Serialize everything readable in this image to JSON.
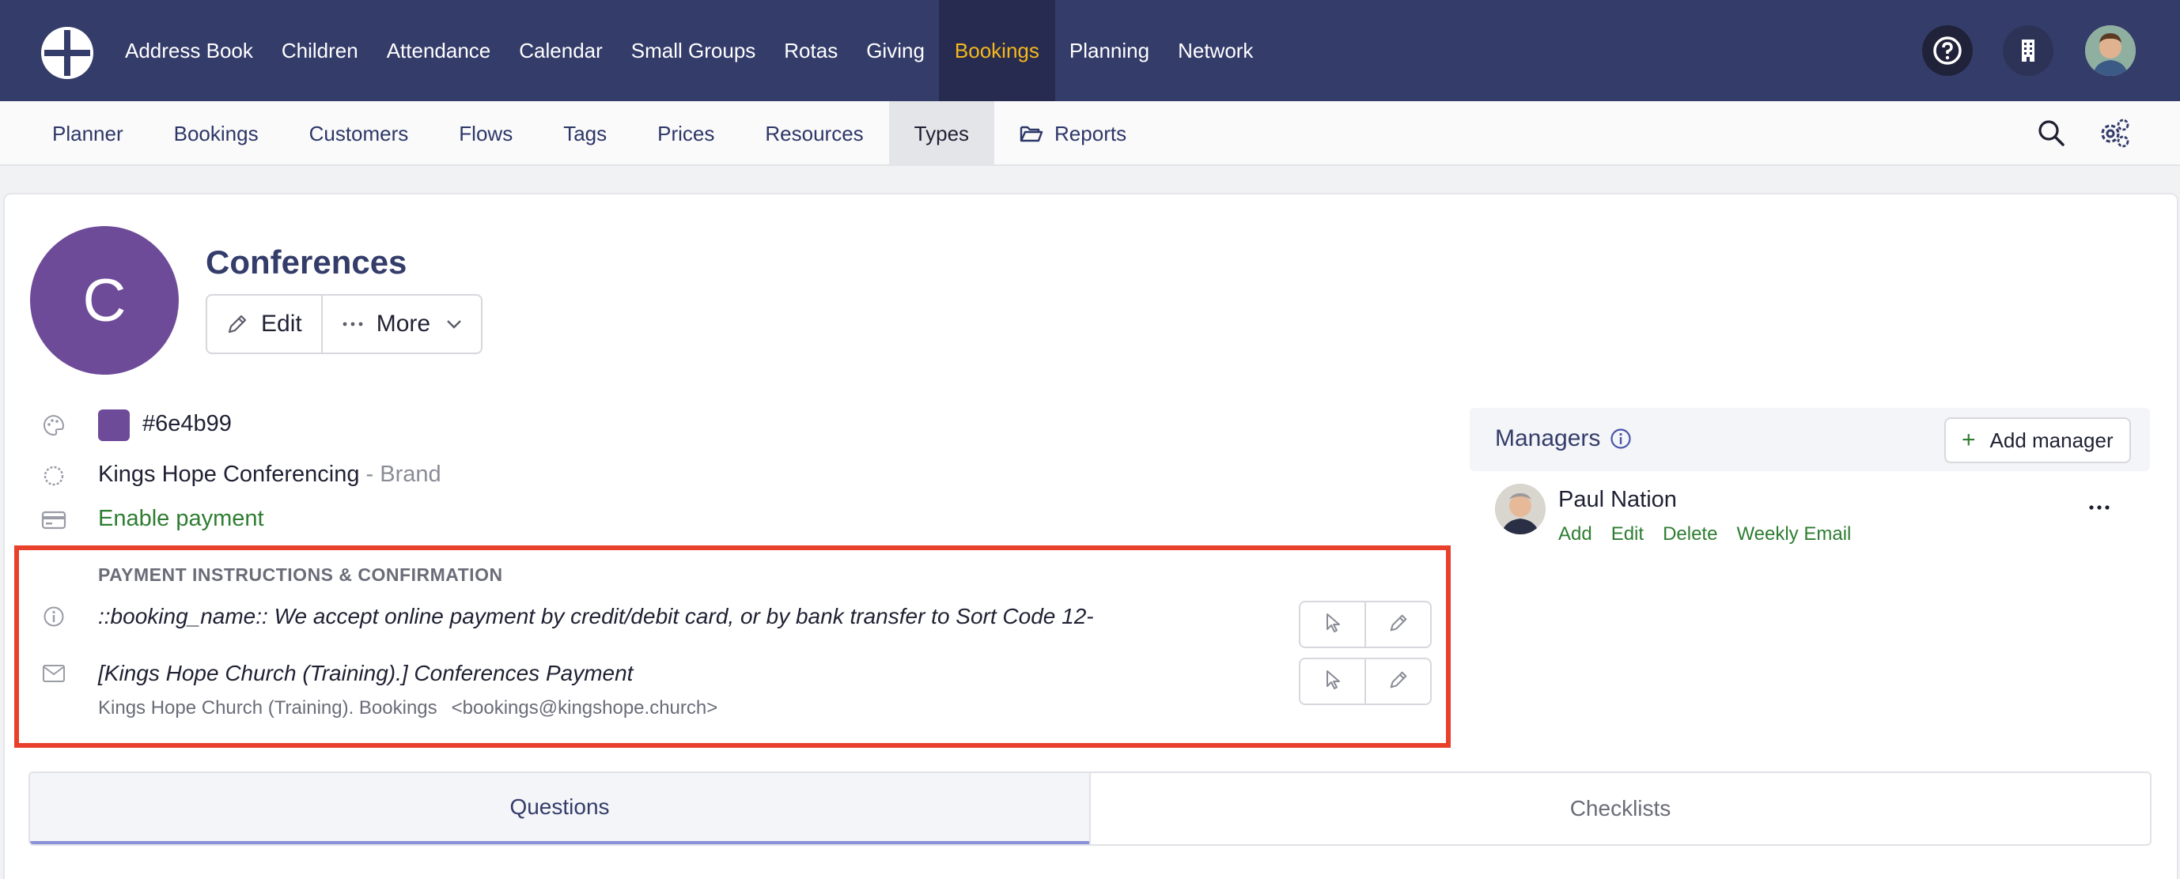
{
  "topnav": {
    "items": [
      {
        "label": "Address Book"
      },
      {
        "label": "Children"
      },
      {
        "label": "Attendance"
      },
      {
        "label": "Calendar"
      },
      {
        "label": "Small Groups"
      },
      {
        "label": "Rotas"
      },
      {
        "label": "Giving"
      },
      {
        "label": "Bookings",
        "active": true
      },
      {
        "label": "Planning"
      },
      {
        "label": "Network"
      }
    ],
    "active_color": "#f5b81c",
    "background": "#343c6a"
  },
  "subnav": {
    "items": [
      {
        "label": "Planner"
      },
      {
        "label": "Bookings"
      },
      {
        "label": "Customers"
      },
      {
        "label": "Flows"
      },
      {
        "label": "Tags"
      },
      {
        "label": "Prices"
      },
      {
        "label": "Resources"
      },
      {
        "label": "Types",
        "active": true
      },
      {
        "label": "Reports",
        "icon": "folder-open-icon"
      }
    ]
  },
  "type": {
    "avatar_letter": "C",
    "title": "Conferences",
    "edit_label": "Edit",
    "more_label": "More",
    "color_hex": "#6e4b99",
    "brand_name": "Kings Hope Conferencing",
    "brand_suffix": "- Brand",
    "payment_label": "Enable payment"
  },
  "payment": {
    "heading": "PAYMENT INSTRUCTIONS & CONFIRMATION",
    "instructions": "::booking_name:: We accept online payment by credit/debit card, or by bank transfer to Sort Code 12-",
    "email_subject": "[Kings Hope Church (Training).] Conferences Payment",
    "sender_name": "Kings Hope Church (Training). Bookings",
    "sender_email": "<bookings@kingshope.church>"
  },
  "managers": {
    "label": "Managers",
    "add_label": "Add manager",
    "list": [
      {
        "name": "Paul Nation",
        "actions": [
          "Add",
          "Edit",
          "Delete",
          "Weekly Email"
        ]
      }
    ]
  },
  "tabs": [
    {
      "label": "Questions",
      "active": true
    },
    {
      "label": "Checklists"
    }
  ]
}
